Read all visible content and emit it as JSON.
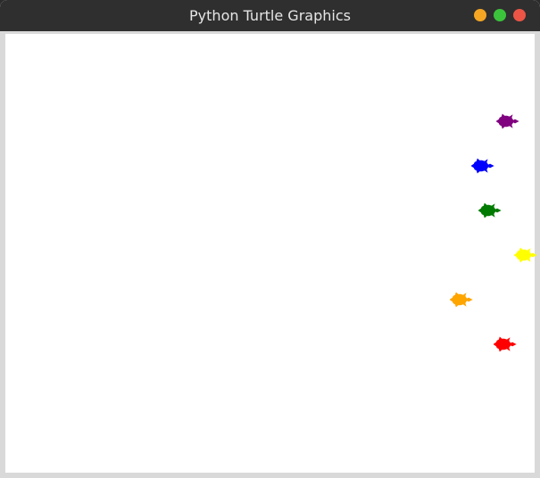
{
  "window": {
    "title": "Python Turtle Graphics",
    "controls": {
      "minimize_color": "#f5a623",
      "maximize_color": "#3cc33c",
      "close_color": "#ec5545"
    },
    "canvas_background": "#ffffff"
  },
  "turtles": [
    {
      "name": "purple",
      "color": "#800080",
      "heading": "east"
    },
    {
      "name": "blue",
      "color": "#0000ff",
      "heading": "east"
    },
    {
      "name": "green",
      "color": "#007a00",
      "heading": "east"
    },
    {
      "name": "yellow",
      "color": "#ffff00",
      "heading": "east"
    },
    {
      "name": "orange",
      "color": "#ffa500",
      "heading": "east"
    },
    {
      "name": "red",
      "color": "#ff0000",
      "heading": "east"
    }
  ]
}
